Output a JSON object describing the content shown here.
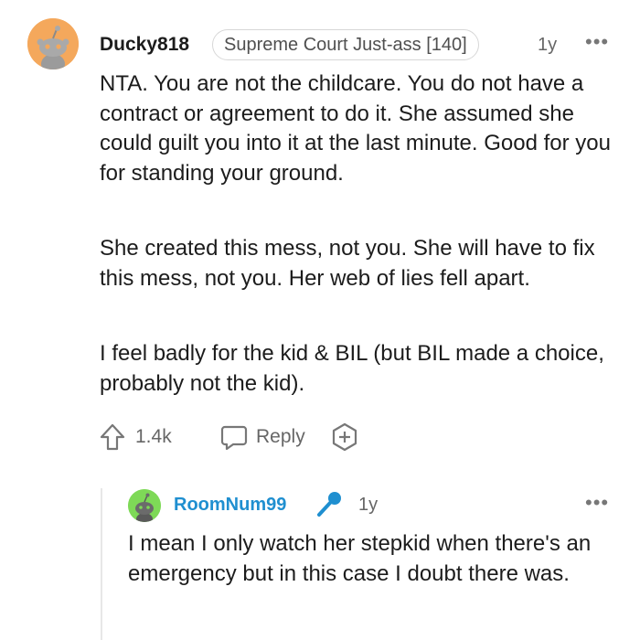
{
  "comment": {
    "username": "Ducky818",
    "flair": "Supreme Court Just-ass [140]",
    "time": "1y",
    "more_icon": "more-horizontal-icon",
    "paragraphs": [
      "NTA. You are not the childcare. You do not have a contract or agreement to do it. She assumed she could guilt you into it at the last minute. Good for you for standing your ground.",
      "She created this mess, not you. She will have to fix this mess, not you. Her web of lies fell apart.",
      "I feel badly for the kid & BIL (but BIL made a choice, probably not the kid)."
    ],
    "votes": "1.4k",
    "reply_label": "Reply",
    "avatar_bg": "#f4a85c"
  },
  "reply": {
    "username": "RoomNum99",
    "time": "1y",
    "text": "I mean I only watch her stepkid when there's an emergency but in this case I doubt there was.",
    "avatar_bg": "#7ed957",
    "username_color": "#1f8fd0",
    "badge_icon": "microphone-icon"
  }
}
